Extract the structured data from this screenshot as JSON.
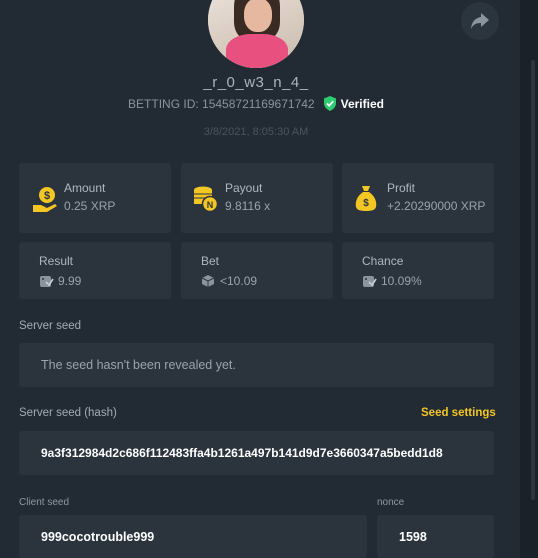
{
  "profile": {
    "username": "_r_0_w3_n_4_",
    "betting_id": "BETTING ID: 15458721169671742",
    "verified_label": "Verified",
    "date": "3/8/2021, 8:05:30 AM"
  },
  "stats": {
    "amount": {
      "label": "Amount",
      "value": "0.25 XRP",
      "icon": "money-bag-hand-icon"
    },
    "payout": {
      "label": "Payout",
      "value": "9.8116 x",
      "icon": "coin-stack-icon"
    },
    "profit": {
      "label": "Profit",
      "value": "+2.20290000 XRP",
      "icon": "money-sack-icon"
    },
    "result": {
      "label": "Result",
      "value": "9.99",
      "icon": "dice-check-icon"
    },
    "bet": {
      "label": "Bet",
      "value": "<10.09",
      "icon": "dice-icon"
    },
    "chance": {
      "label": "Chance",
      "value": "10.09%",
      "icon": "dice-check-icon"
    }
  },
  "server_seed": {
    "label": "Server seed",
    "value": "The seed hasn't been revealed yet."
  },
  "server_seed_hash": {
    "label": "Server seed (hash)",
    "settings_link": "Seed settings",
    "value": "9a3f312984d2c686f112483ffa4b1261a497b141d9d7e3660347a5bedd1d8"
  },
  "client_seed": {
    "label": "Client seed",
    "value": "999cocotrouble999"
  },
  "nonce": {
    "label": "nonce",
    "value": "1598"
  },
  "colors": {
    "background": "#222b33",
    "card": "#2b343d",
    "accent_yellow": "#f3c623",
    "verified_green": "#2ecc71"
  }
}
